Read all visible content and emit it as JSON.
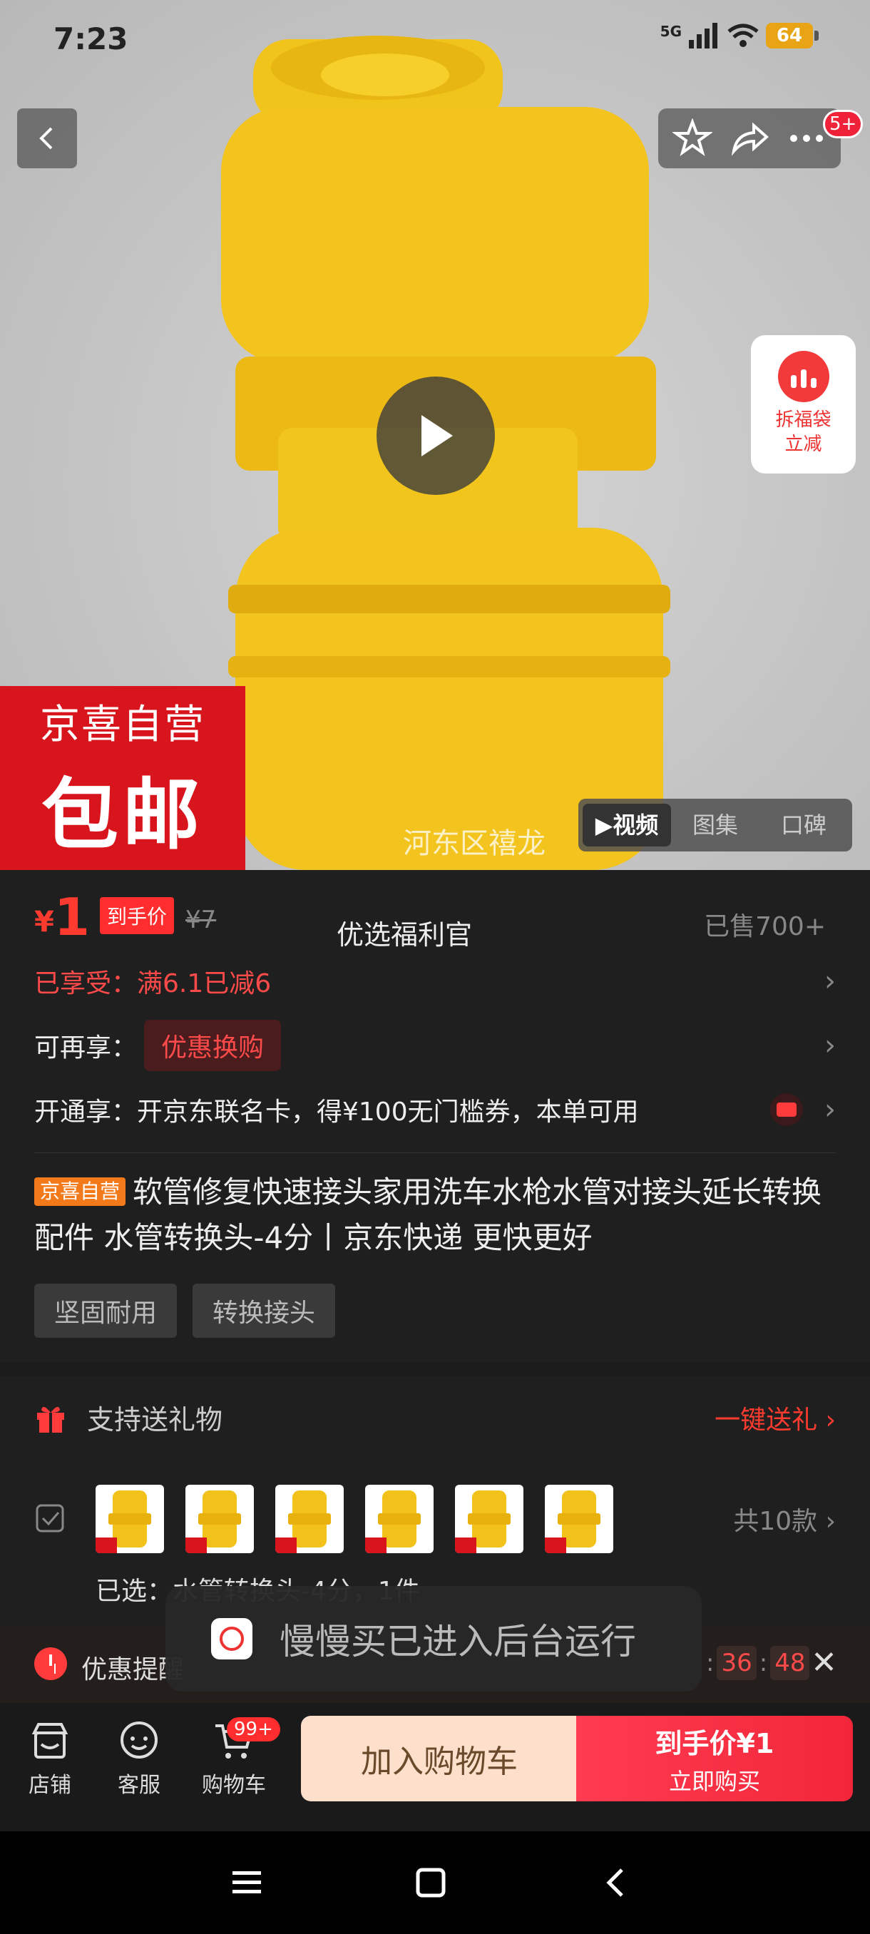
{
  "status": {
    "time": "7:23",
    "network": "5G",
    "battery": "64"
  },
  "header": {
    "notif_badge": "5+"
  },
  "floating": {
    "fudai_line1": "拆福袋",
    "fudai_line2": "立减"
  },
  "hero": {
    "promo_line1": "京喜自营",
    "promo_line2": "包邮",
    "watermark": "河东区禧龙",
    "tabs": [
      "▶视频",
      "图集",
      "口碑"
    ]
  },
  "price": {
    "currency": "¥",
    "value": "1",
    "tag": "到手价",
    "original": "¥7",
    "welfare_label": "优选福利官",
    "sold": "已售700+"
  },
  "promos": {
    "enjoyed": "已享受：满6.1已减6",
    "more_label": "可再享：",
    "more_button": "优惠换购",
    "card_offer": "开通享：开京东联名卡，得¥100无门槛券，本单可用"
  },
  "product": {
    "self_tag": "京喜自营",
    "title": "软管修复快速接头家用洗车水枪水管对接头延长转换配件 水管转换头-4分丨京东快递 更快更好",
    "chips": [
      "坚固耐用",
      "转换接头"
    ]
  },
  "gift": {
    "label": "支持送礼物",
    "link": "一键送礼 ›"
  },
  "variants": {
    "count": "共10款",
    "selected": "已选：水管转换头-4分，1件"
  },
  "toast": {
    "text": "慢慢买已进入后台运行"
  },
  "reminder": {
    "label": "优惠提醒",
    "t1": "36",
    "t2": "48"
  },
  "bottom": {
    "nav": [
      "店铺",
      "客服",
      "购物车"
    ],
    "cart_badge": "99+",
    "add_to_cart": "加入购物车",
    "buy_line1": "到手价¥1",
    "buy_line2": "立即购买"
  },
  "colors": {
    "accent": "#ff3b30",
    "promo_red": "#d8141c",
    "product_yellow": "#f3c21a"
  }
}
